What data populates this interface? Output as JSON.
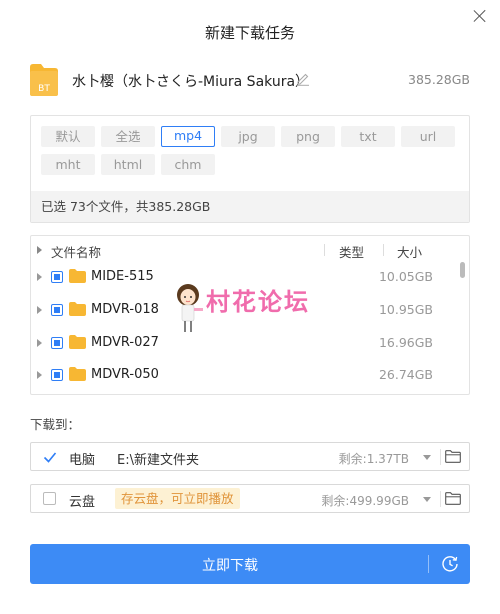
{
  "dialog": {
    "title": "新建下载任务"
  },
  "task": {
    "icon_label": "BT",
    "name": "水卜樱（水卜さくら-Miura Sakura）",
    "size": "385.28GB"
  },
  "filters": {
    "chips": [
      "默认",
      "全选",
      "mp4",
      "jpg",
      "png",
      "txt",
      "url",
      "mht",
      "html",
      "chm"
    ],
    "active": "mp4",
    "summary": "已选 73个文件，共385.28GB"
  },
  "file_list": {
    "headers": {
      "name": "文件名称",
      "type": "类型",
      "size": "大小"
    },
    "rows": [
      {
        "name": "MIDE-515",
        "size": "10.05GB"
      },
      {
        "name": "MDVR-018",
        "size": "10.95GB"
      },
      {
        "name": "MDVR-027",
        "size": "16.96GB"
      },
      {
        "name": "MDVR-050",
        "size": "26.74GB"
      }
    ]
  },
  "watermark": {
    "text": "村花论坛"
  },
  "download_to": {
    "label": "下载到：",
    "computer": {
      "title": "电脑",
      "path": "E:\\新建文件夹",
      "free": "剩余:1.37TB",
      "checked": true
    },
    "cloud": {
      "title": "云盘",
      "tag": "存云盘，可立即播放",
      "free": "剩余:499.99GB",
      "checked": false
    }
  },
  "button": {
    "label": "立即下载"
  },
  "colors": {
    "accent": "#2f7ef6",
    "button": "#3d8bf5",
    "folder": "#f7b733",
    "tag_bg": "#fdf1d3",
    "tag_text": "#e0943a",
    "watermark": "#f06cac"
  }
}
